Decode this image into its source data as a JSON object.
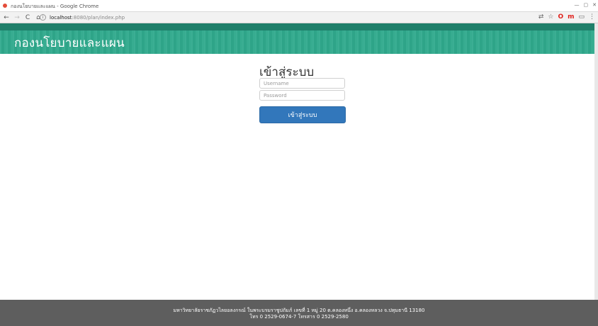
{
  "window": {
    "title": "กองนโยบายและแผน - Google Chrome",
    "controls": [
      "—",
      "▢",
      "✕"
    ]
  },
  "browser": {
    "back": "←",
    "forward": "→",
    "reload": "C",
    "home": "⌂",
    "url_host": "localhost",
    "url_path": ":8080/plan/index.php",
    "ext_icons": {
      "translate": "⇄",
      "star": "☆",
      "opera": "O",
      "m": "m",
      "cast": "▭",
      "menu": "⋮"
    }
  },
  "header": {
    "title": "กองนโยบายและแผน"
  },
  "login": {
    "heading": "เข้าสู่ระบบ",
    "username_placeholder": "Username",
    "password_placeholder": "Password",
    "submit_label": "เข้าสู่ระบบ"
  },
  "footer": {
    "line1": "มหาวิทยาลัยราชภัฏวไลยอลงกรณ์ ในพระบรมราชูปถัมภ์ เลขที่ 1 หมู่ 20 ต.คลองหนึ่ง อ.คลองหลวง จ.ปทุมธานี 13180",
    "line2": "โทร 0 2529-0674-7 โทรสาร 0 2529-2580"
  },
  "colors": {
    "header": "#2fa98c",
    "button": "#3277bb",
    "footer": "#5e5e5e"
  }
}
